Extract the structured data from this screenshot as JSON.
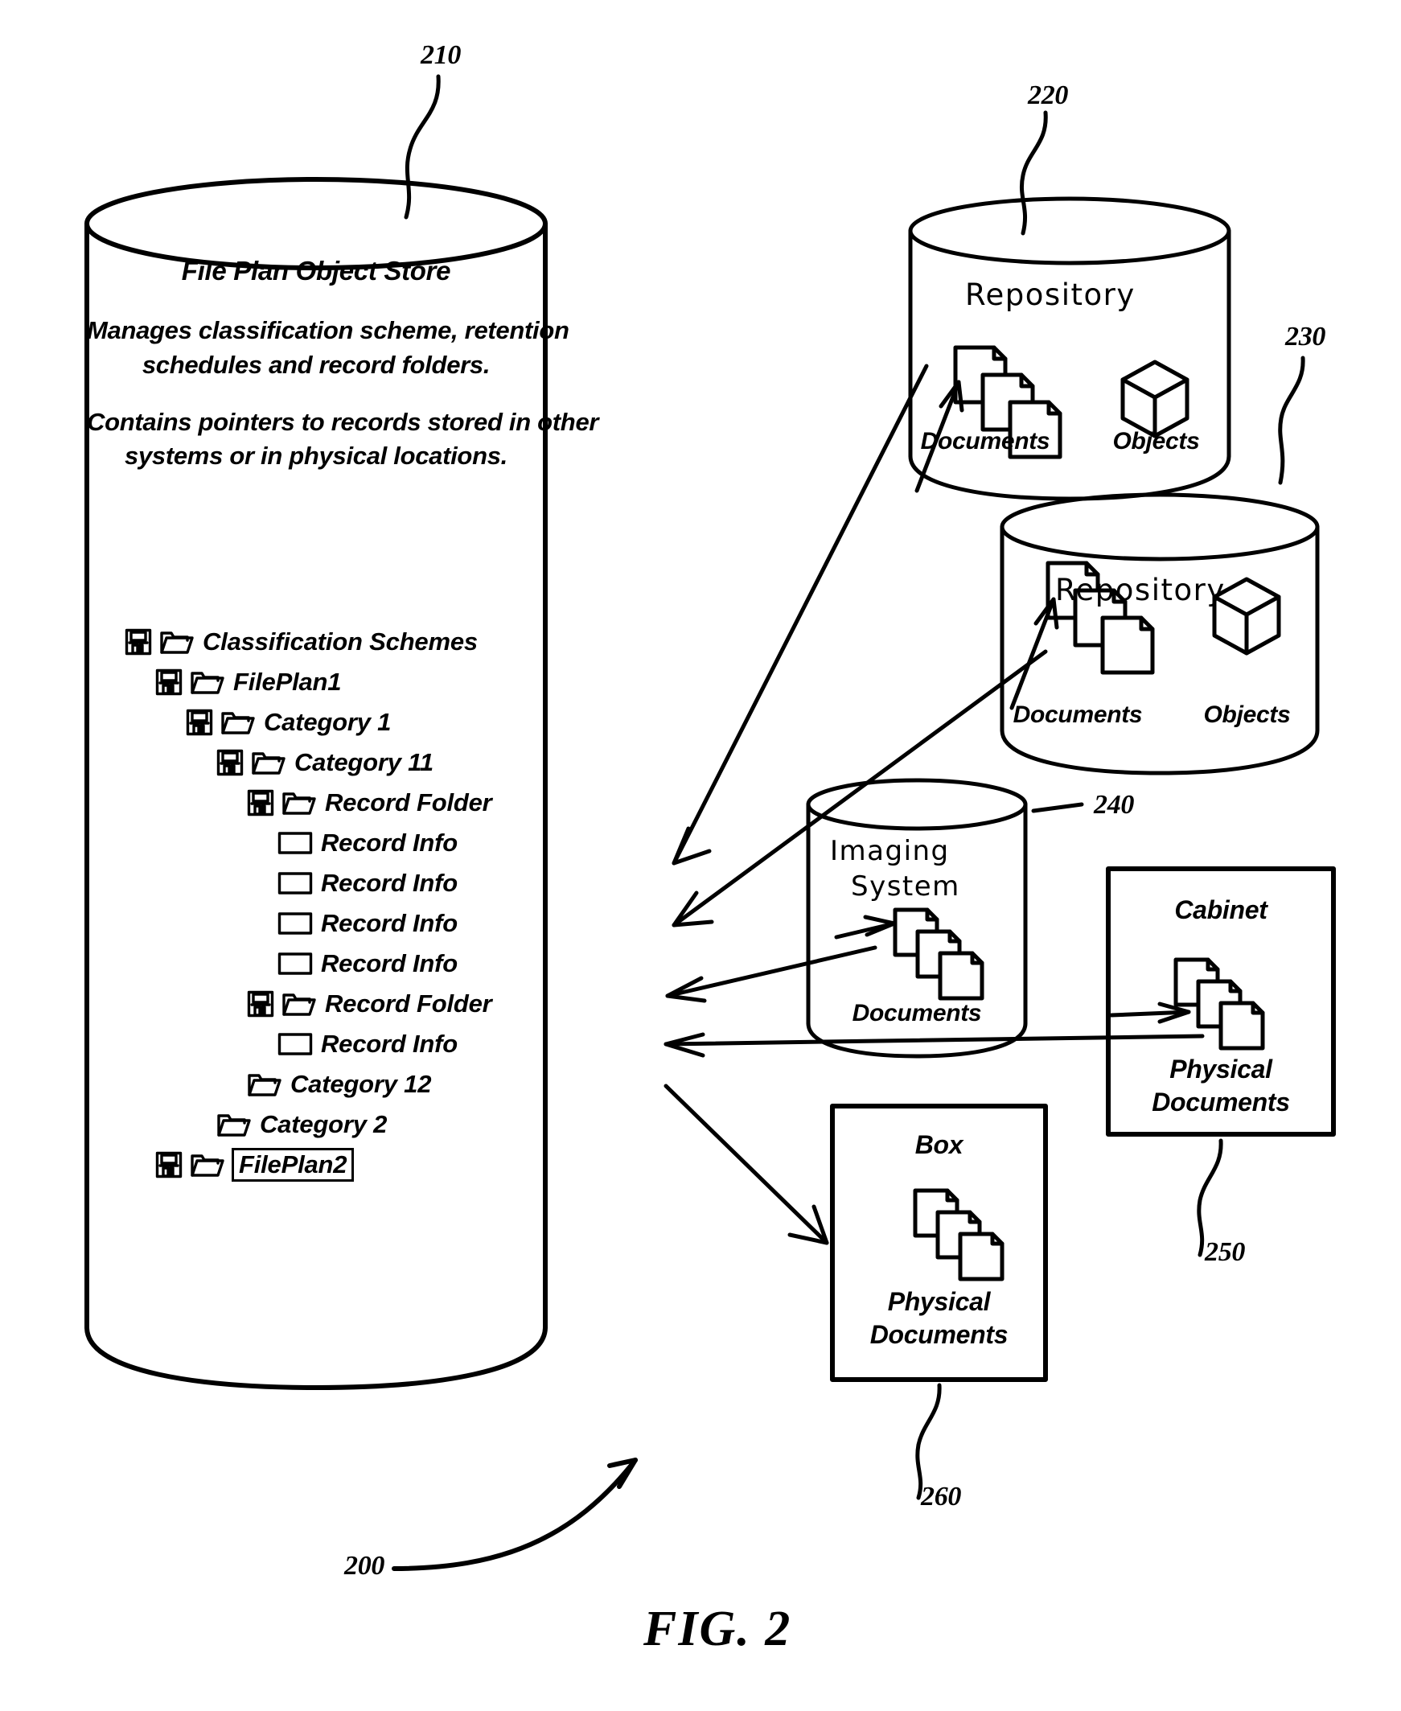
{
  "figure": {
    "label": "FIG. 2",
    "system_ref": "200"
  },
  "refs": {
    "file_plan_object_store": "210",
    "repository_top": "220",
    "repository_bottom": "230",
    "imaging_system": "240",
    "cabinet": "250",
    "box": "260"
  },
  "file_plan_object_store": {
    "title": "File Plan Object Store",
    "paragraph1_line1": "Manages classification scheme, retention",
    "paragraph1_line2": "schedules and record folders.",
    "paragraph2_line1": "Contains pointers to records stored in other",
    "paragraph2_line2": "systems or in physical locations.",
    "tree": [
      {
        "label": "Classification Schemes",
        "depth": 0,
        "icons": [
          "save-icon",
          "folder-icon"
        ],
        "selected": false
      },
      {
        "label": "FilePlan1",
        "depth": 1,
        "icons": [
          "save-icon",
          "folder-icon"
        ],
        "selected": false
      },
      {
        "label": "Category 1",
        "depth": 2,
        "icons": [
          "save-icon",
          "folder-icon"
        ],
        "selected": false
      },
      {
        "label": "Category 11",
        "depth": 3,
        "icons": [
          "save-icon",
          "folder-icon"
        ],
        "selected": false
      },
      {
        "label": "Record Folder",
        "depth": 4,
        "icons": [
          "save-icon",
          "folder-icon"
        ],
        "selected": false
      },
      {
        "label": "Record Info",
        "depth": 5,
        "icons": [
          "record-icon"
        ],
        "selected": false
      },
      {
        "label": "Record Info",
        "depth": 5,
        "icons": [
          "record-icon"
        ],
        "selected": false
      },
      {
        "label": "Record Info",
        "depth": 5,
        "icons": [
          "record-icon"
        ],
        "selected": false
      },
      {
        "label": "Record Info",
        "depth": 5,
        "icons": [
          "record-icon"
        ],
        "selected": false
      },
      {
        "label": "Record Folder",
        "depth": 4,
        "icons": [
          "save-icon",
          "folder-icon"
        ],
        "selected": false
      },
      {
        "label": "Record Info",
        "depth": 5,
        "icons": [
          "record-icon"
        ],
        "selected": false
      },
      {
        "label": "Category 12",
        "depth": 4,
        "icons": [
          "folder-icon"
        ],
        "selected": false
      },
      {
        "label": "Category 2",
        "depth": 3,
        "icons": [
          "folder-icon"
        ],
        "selected": false
      },
      {
        "label": "FilePlan2",
        "depth": 1,
        "icons": [
          "save-icon",
          "folder-icon"
        ],
        "selected": true
      }
    ]
  },
  "repository_top": {
    "title": "Repository",
    "documents_label": "Documents",
    "objects_label": "Objects"
  },
  "repository_bottom": {
    "title": "Repository",
    "documents_label": "Documents",
    "objects_label": "Objects"
  },
  "imaging_system": {
    "title_line1": "Imaging",
    "title_line2": "System",
    "documents_label": "Documents"
  },
  "cabinet": {
    "title": "Cabinet",
    "contents_line1": "Physical",
    "contents_line2": "Documents"
  },
  "box": {
    "title": "Box",
    "contents_line1": "Physical",
    "contents_line2": "Documents"
  },
  "colors": {
    "ink": "#000000",
    "paper": "#ffffff"
  }
}
